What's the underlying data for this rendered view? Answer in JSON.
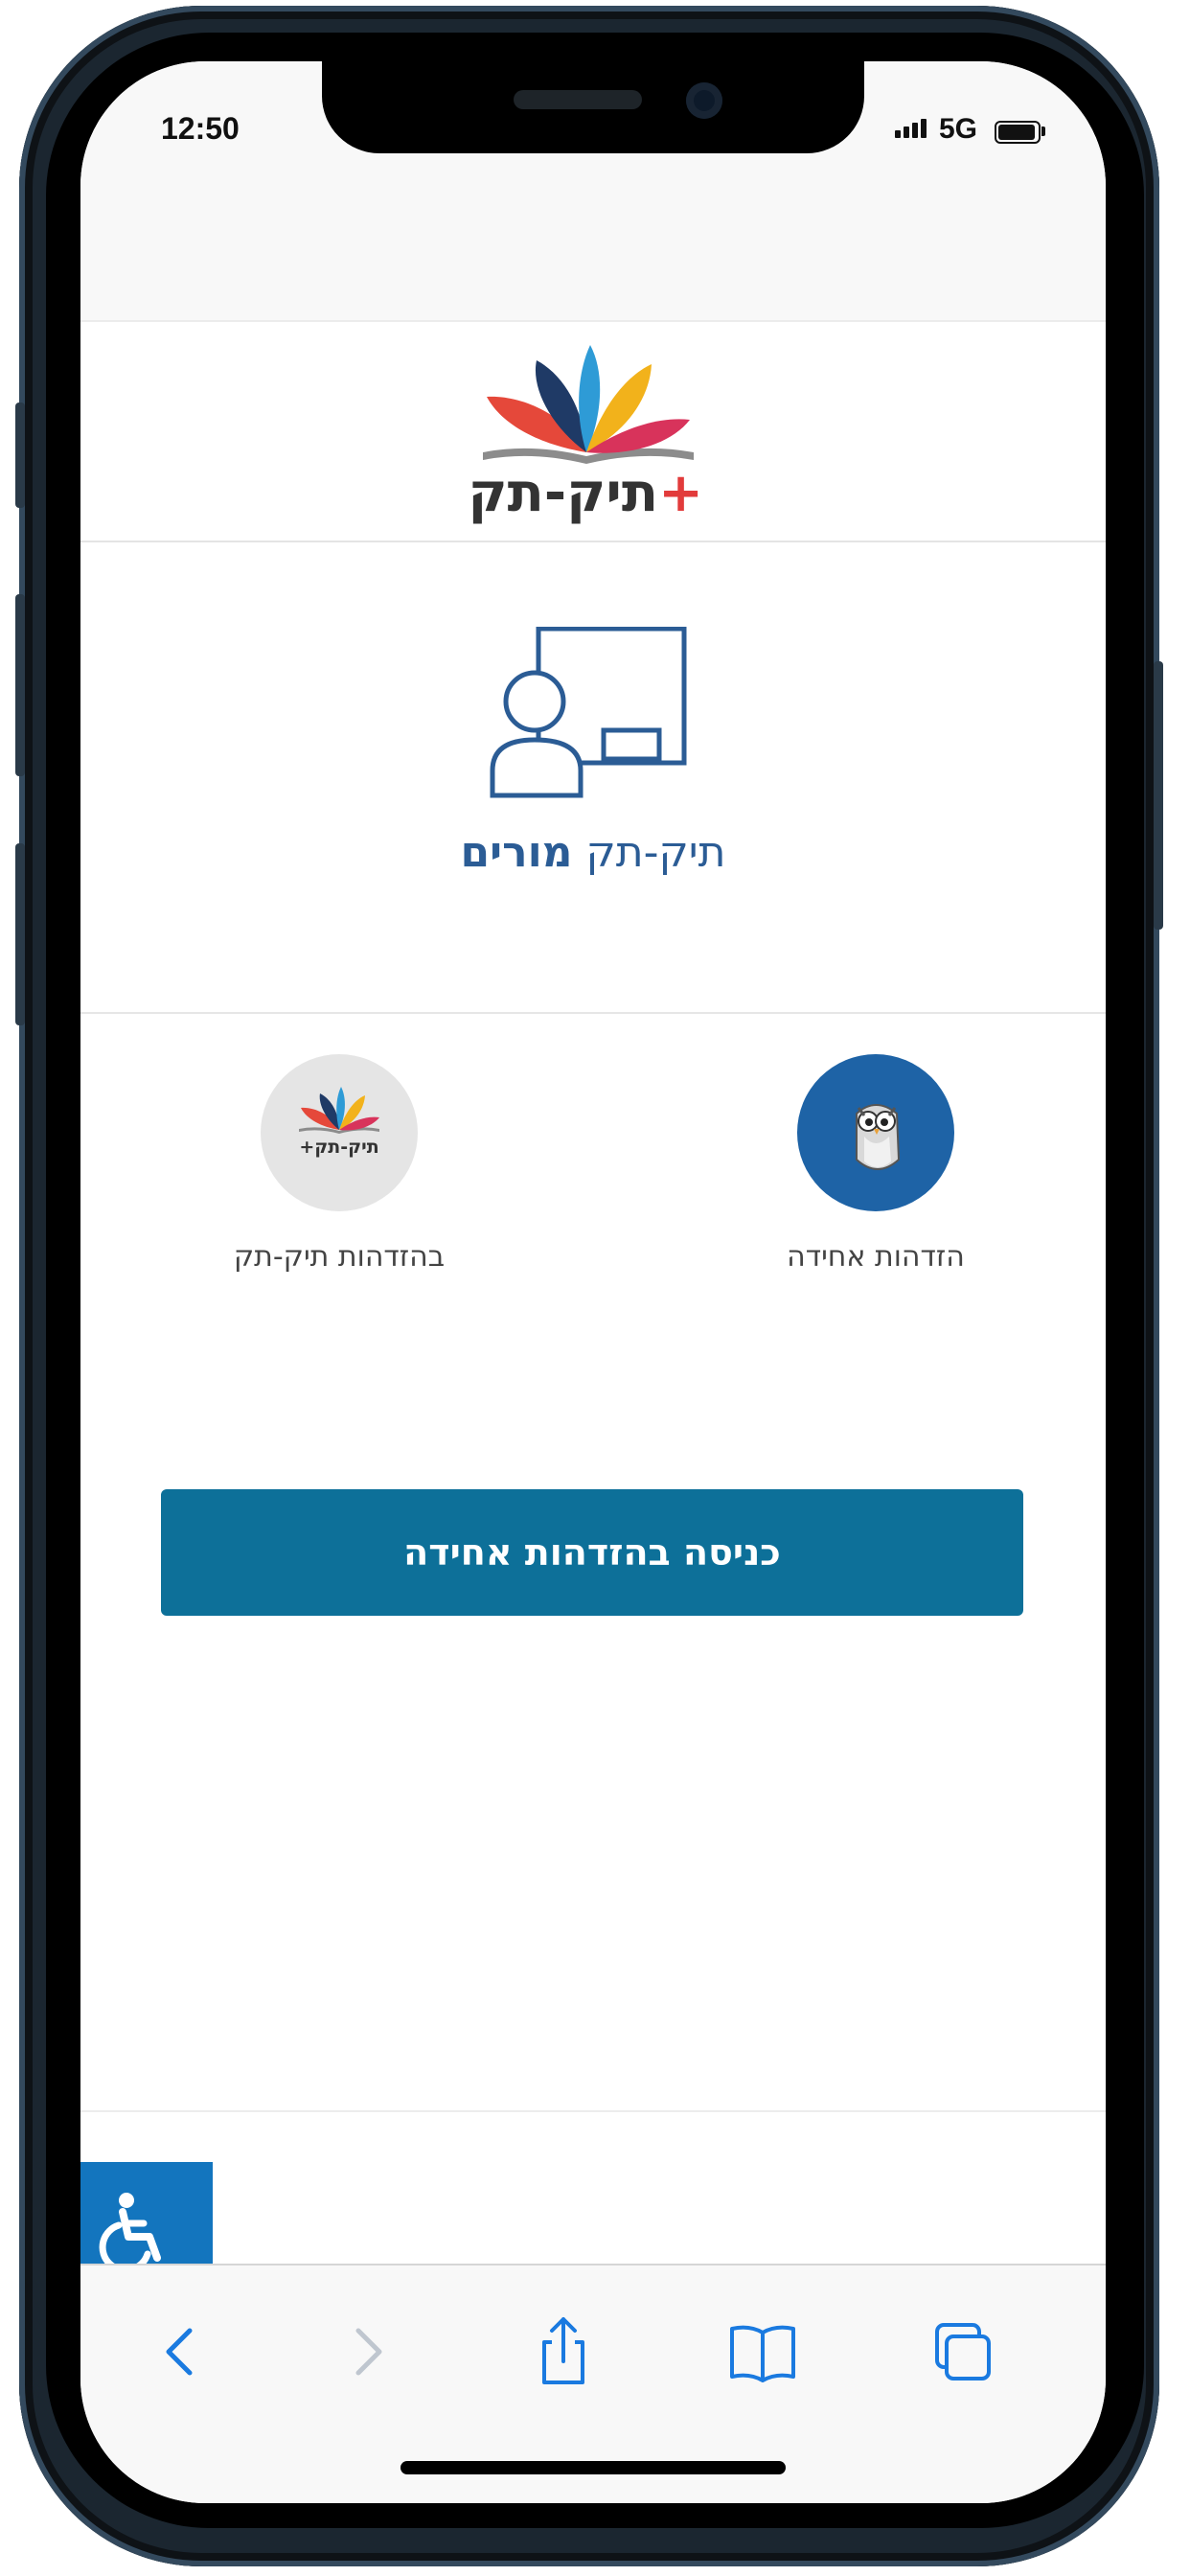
{
  "status_bar": {
    "time": "12:50",
    "network": "5G"
  },
  "header": {
    "logo_text_main": "תיק-תק",
    "logo_text_plus": "+"
  },
  "teacher_section": {
    "title_part1": "תיק-תק",
    "title_part2": "מורים"
  },
  "login_options": [
    {
      "label": "הזדהות אחידה",
      "icon": "owl-icon"
    },
    {
      "label": "בהזדהות תיק-תק",
      "icon": "tiktak-logo-icon",
      "logo_text": "תיק-תק+"
    }
  ],
  "login_button": {
    "label": "כניסה בהזדהות אחידה"
  },
  "accessibility": {
    "icon": "wheelchair-icon"
  },
  "safari_toolbar": {
    "icons": [
      "back-arrow-icon",
      "forward-arrow-icon",
      "share-icon",
      "bookmarks-icon",
      "tabs-icon"
    ],
    "accent_color": "#1a7ae0",
    "disabled_color": "#bfc6cf"
  },
  "colors": {
    "primary_button": "#0d7099",
    "teacher_title": "#2b5c95",
    "owl_circle": "#1e63a6",
    "accessibility_button": "#1375be"
  }
}
